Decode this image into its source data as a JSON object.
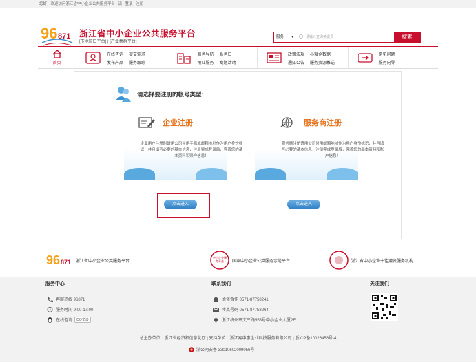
{
  "topbar": {
    "welcome": "您好，欢迎访问浙江省中小企业公共服务平台",
    "login": "请",
    "login2": "登录",
    "register": "注册"
  },
  "header": {
    "title": "浙江省中小企业公共服务平台",
    "subtitle": "[市地窗口平台] | [产业集群平台]"
  },
  "search": {
    "type": "服务",
    "placeholder": "请输入查询关键词",
    "button": "搜索"
  },
  "nav": {
    "home": "首页",
    "groups": [
      {
        "links": [
          "在线咨询",
          "提交需求",
          "发布产品",
          "服务跟踪"
        ]
      },
      {
        "links": [
          "服务导航",
          "服务日",
          "抢业服务",
          "专题活动"
        ]
      },
      {
        "links": [
          "政策法规",
          "小微企数据",
          "通知公告",
          "服务资源推送"
        ]
      },
      {
        "links": [
          "常见问题",
          "服务向导"
        ]
      }
    ]
  },
  "registration": {
    "question": "请选择要注册的帐号类型:",
    "enterprise": {
      "title": "企业注册",
      "desc": "企业用户注册时请用公司常用手机或邮箱地址作为用户身份标识，并且填写必要的基本信息，注册完成登录后，完善您的基本资料和账户信息！",
      "button": "点击进入"
    },
    "provider": {
      "title": "服务商注册",
      "desc": "服务商注册请用公司常用邮箱地址作为用户身份标识，并且填写必要的基本信息，注册完成登录后，完善您的基本资料和账户信息！",
      "button": "点击进入"
    }
  },
  "partners": [
    {
      "label": "浙江省中小企业公共服务平台"
    },
    {
      "label": "国家中小企业公共服务示范平台",
      "seal": "中小企业服务平台"
    },
    {
      "label": "浙江省中小企业十佳融资服务机构"
    }
  ],
  "footer": {
    "service_center": "服务中心",
    "contact": "联系我们",
    "follow": "关注我们",
    "hotline": "客服热线 96871",
    "hours": "服务时间 9:00-17:00",
    "online": "在线咨询",
    "qq": "QQ交谈",
    "coop": "洽谈合作 0571-87758241",
    "fax": "传真号码 0571-87758264",
    "address": "浙江杭州市文三路553号中小企业大厦2F",
    "copyright": "总主办单位：浙江省经济和信息化厅 | 支持单位：浙江易中惠企业科技服务有限公司 | 浙ICP备10026456号-4",
    "police": "浙公网安备 33010602009056号"
  },
  "colors": {
    "brand": "#c8102e",
    "accent": "#e8731e",
    "button": "#2f7fc4"
  }
}
